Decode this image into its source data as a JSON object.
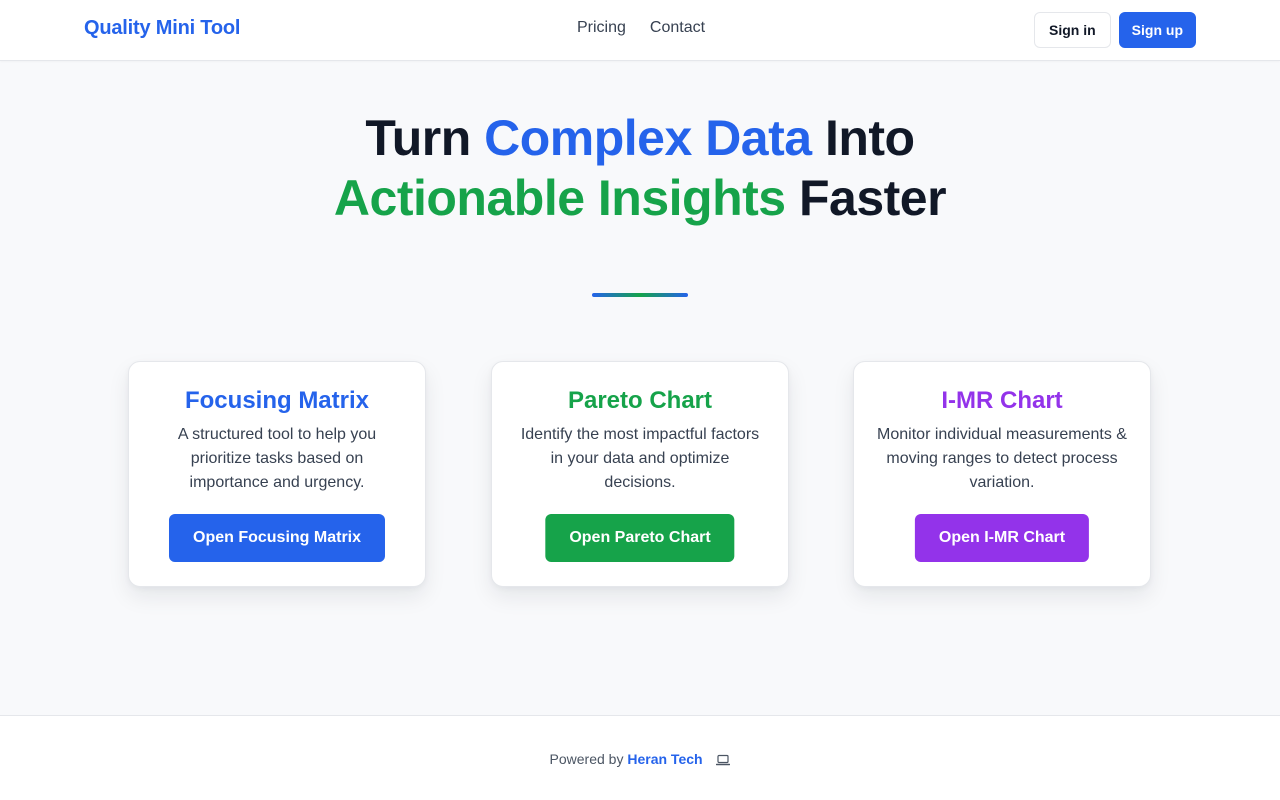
{
  "header": {
    "brand": "Quality Mini Tool",
    "nav": [
      "Pricing",
      "Contact"
    ],
    "signin_label": "Sign in",
    "signup_label": "Sign up"
  },
  "hero": {
    "line1": {
      "part1": "Turn ",
      "highlight": "Complex Data",
      "part2": " Into"
    },
    "line2": {
      "highlight": "Actionable Insights",
      "part2": " Faster"
    }
  },
  "colors": {
    "blue": "#2563eb",
    "green": "#16a34a",
    "purple": "#9333ea",
    "dark": "#111827"
  },
  "cards": [
    {
      "title": "Focusing Matrix",
      "description": "A structured tool to help you prioritize tasks based on importance and urgency.",
      "button": "Open Focusing Matrix",
      "color": "#2563eb"
    },
    {
      "title": "Pareto Chart",
      "description": "Identify the most impactful factors in your data and optimize decisions.",
      "button": "Open Pareto Chart",
      "color": "#16a34a"
    },
    {
      "title": "I-MR Chart",
      "description": "Monitor individual measurements & moving ranges to detect process variation.",
      "button": "Open I-MR Chart",
      "color": "#9333ea"
    }
  ],
  "footer": {
    "powered_by": "Powered by ",
    "company": "Heran Tech",
    "icon": "laptop-icon"
  }
}
